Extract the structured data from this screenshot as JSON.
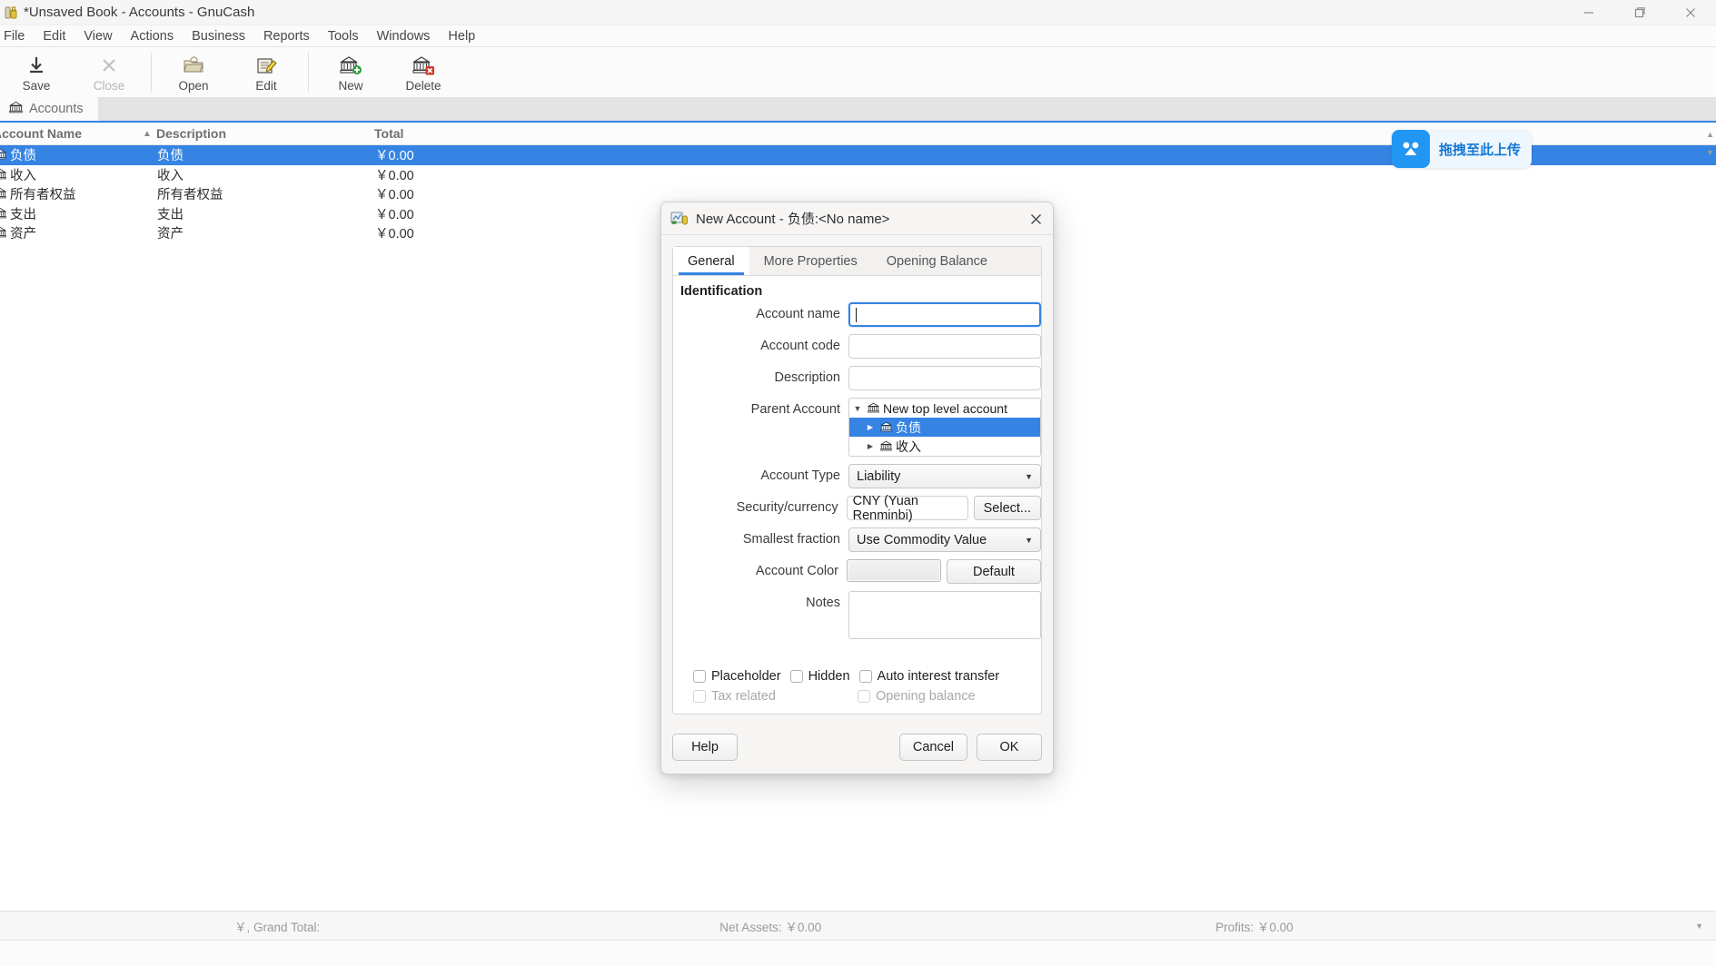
{
  "window": {
    "title": "*Unsaved Book - Accounts - GnuCash",
    "icon": "gnucash-lock-icon",
    "controls": {
      "minimize": "minimize-icon",
      "maximize": "maximize-icon",
      "close": "close-icon"
    }
  },
  "menubar": {
    "items": [
      {
        "label": "File"
      },
      {
        "label": "Edit"
      },
      {
        "label": "View"
      },
      {
        "label": "Actions"
      },
      {
        "label": "Business"
      },
      {
        "label": "Reports"
      },
      {
        "label": "Tools"
      },
      {
        "label": "Windows"
      },
      {
        "label": "Help"
      }
    ]
  },
  "toolbar": {
    "buttons": [
      {
        "label": "Save",
        "icon": "save-icon",
        "disabled": false
      },
      {
        "label": "Close",
        "icon": "close-x-icon",
        "disabled": true
      },
      {
        "label": "Open",
        "icon": "open-folder-icon",
        "disabled": false
      },
      {
        "label": "Edit",
        "icon": "edit-account-icon",
        "disabled": false
      },
      {
        "label": "New",
        "icon": "new-account-icon",
        "disabled": false
      },
      {
        "label": "Delete",
        "icon": "delete-account-icon",
        "disabled": false
      }
    ]
  },
  "tabstrip": {
    "tabs": [
      {
        "label": "Accounts",
        "icon": "bank-icon",
        "active": true
      }
    ]
  },
  "account_tree": {
    "columns": [
      {
        "label": "Account Name",
        "sort": "ascending"
      },
      {
        "label": "Description"
      },
      {
        "label": "Total"
      }
    ],
    "rows": [
      {
        "name": "负债",
        "description": "负债",
        "total": "￥0.00",
        "selected": true
      },
      {
        "name": "收入",
        "description": "收入",
        "total": "￥0.00",
        "selected": false
      },
      {
        "name": "所有者权益",
        "description": "所有者权益",
        "total": "￥0.00",
        "selected": false
      },
      {
        "name": "支出",
        "description": "支出",
        "total": "￥0.00",
        "selected": false
      },
      {
        "name": "资产",
        "description": "资产",
        "total": "￥0.00",
        "selected": false
      }
    ]
  },
  "upload_widget": {
    "label": "拖拽至此上传",
    "icon": "baidu-netdisk-icon",
    "accent": "#2196f3"
  },
  "statusbar": {
    "grand_total": "￥, Grand Total:",
    "net_assets": "Net Assets: ￥0.00",
    "profits": "Profits: ￥0.00",
    "caret": "▼"
  },
  "dialog": {
    "title": "New Account - 负债:<No name>",
    "icon": "new-account-dialog-icon",
    "close_icon": "close-icon",
    "tabs": [
      {
        "label": "General",
        "active": true
      },
      {
        "label": "More Properties",
        "active": false
      },
      {
        "label": "Opening Balance",
        "active": false
      }
    ],
    "section_title": "Identification",
    "fields": {
      "account_name": {
        "label": "Account name",
        "value": "",
        "placeholder": ""
      },
      "account_code": {
        "label": "Account code",
        "value": "",
        "placeholder": ""
      },
      "description": {
        "label": "Description",
        "value": "",
        "placeholder": ""
      },
      "parent_account": {
        "label": "Parent Account",
        "rows": [
          {
            "label": "New top level account",
            "expander": "▼",
            "icon": "bank-icon",
            "selected": false,
            "indent": false
          },
          {
            "label": "负债",
            "expander": "▶",
            "icon": "bank-icon",
            "selected": true,
            "indent": true
          },
          {
            "label": "收入",
            "expander": "▶",
            "icon": "bank-icon",
            "selected": false,
            "indent": true
          }
        ]
      },
      "account_type": {
        "label": "Account Type",
        "value": "Liability"
      },
      "security_currency": {
        "label": "Security/currency",
        "value": "CNY (Yuan Renminbi)",
        "button": "Select..."
      },
      "smallest_fraction": {
        "label": "Smallest fraction",
        "value": "Use Commodity Value"
      },
      "account_color": {
        "label": "Account Color",
        "value": "",
        "button": "Default"
      },
      "notes": {
        "label": "Notes",
        "value": ""
      }
    },
    "checkboxes": [
      {
        "label": "Placeholder",
        "checked": false,
        "disabled": false
      },
      {
        "label": "Hidden",
        "checked": false,
        "disabled": false
      },
      {
        "label": "Auto interest transfer",
        "checked": false,
        "disabled": false
      },
      {
        "label": "Tax related",
        "checked": false,
        "disabled": true
      },
      {
        "label": "Opening balance",
        "checked": false,
        "disabled": true
      }
    ],
    "actions": {
      "help": "Help",
      "cancel": "Cancel",
      "ok": "OK"
    }
  }
}
